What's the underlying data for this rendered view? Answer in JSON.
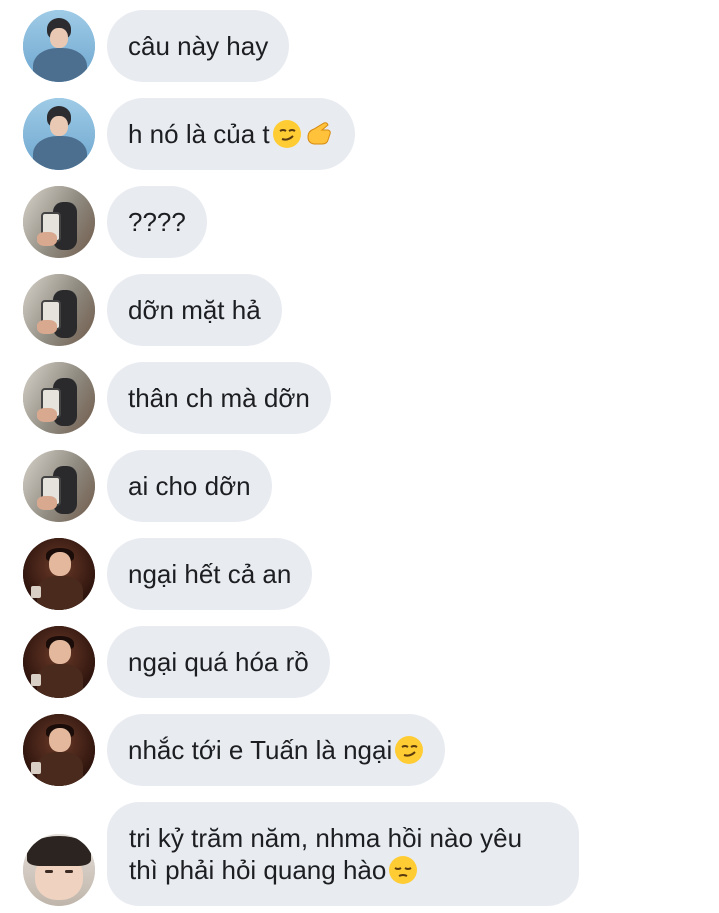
{
  "messages": [
    {
      "avatar": "blue-shirt-avatar",
      "text": "câu này hay",
      "emojis": []
    },
    {
      "avatar": "blue-shirt-avatar",
      "text": "h nó là của t",
      "emojis": [
        "smirk-emoji",
        "pointing-hand-emoji"
      ]
    },
    {
      "avatar": "mirror-selfie-avatar",
      "text": "????",
      "emojis": []
    },
    {
      "avatar": "mirror-selfie-avatar",
      "text": "dỡn mặt hả",
      "emojis": []
    },
    {
      "avatar": "mirror-selfie-avatar",
      "text": "thân ch mà dỡn",
      "emojis": []
    },
    {
      "avatar": "mirror-selfie-avatar",
      "text": "ai cho dỡn",
      "emojis": []
    },
    {
      "avatar": "dark-portrait-avatar",
      "text": "ngại hết cả an",
      "emojis": []
    },
    {
      "avatar": "dark-portrait-avatar",
      "text": "ngại quá hóa rồ",
      "emojis": []
    },
    {
      "avatar": "dark-portrait-avatar",
      "text": "nhắc tới e Tuấn là ngại",
      "emojis": [
        "smirk-emoji"
      ]
    },
    {
      "avatar": "closeup-face-avatar",
      "line1": "tri kỷ trăm năm, nhma hồi nào yêu",
      "line2": "thì phải hỏi quang hào",
      "emojis": [
        "pensive-emoji"
      ]
    }
  ],
  "colors": {
    "bubble": "#e8ebf0",
    "text": "#1c1e21",
    "background": "#ffffff"
  }
}
